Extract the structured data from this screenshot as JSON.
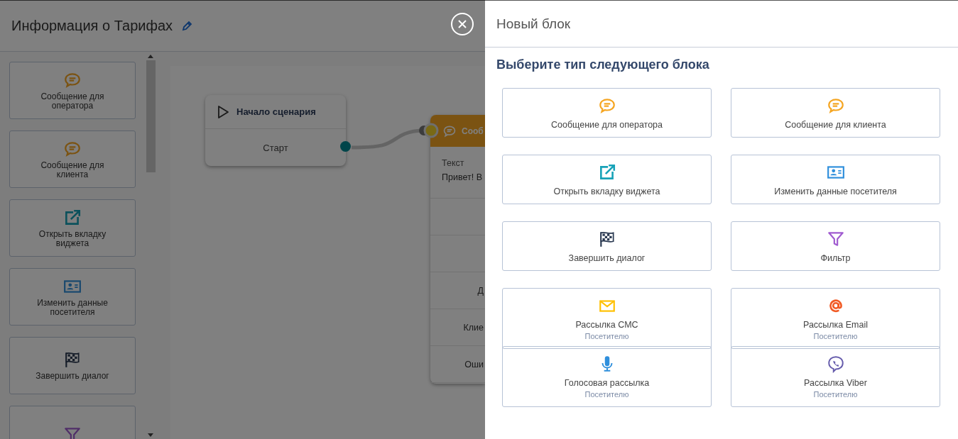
{
  "editor": {
    "title": "Информация о Тарифах"
  },
  "palette": [
    {
      "kind": "chat",
      "label": "Сообщение для оператора"
    },
    {
      "kind": "chat",
      "label": "Сообщение для клиента"
    },
    {
      "kind": "external",
      "label": "Открыть вкладку виджета"
    },
    {
      "kind": "contact",
      "label": "Изменить данные посетителя"
    },
    {
      "kind": "flag",
      "label": "Завершить диалог"
    },
    {
      "kind": "filter"
    }
  ],
  "canvas": {
    "start_node": {
      "title": "Начало сценария",
      "output": "Старт"
    },
    "message_node": {
      "title": "Сооб",
      "field_label": "Текст",
      "field_value": "Привет! В",
      "rows": [
        "",
        "",
        "Д",
        "Клие",
        "Оши"
      ]
    }
  },
  "panel": {
    "title": "Новый блок",
    "subtitle": "Выберите тип следующего блока",
    "options": [
      {
        "kind": "chat",
        "label": "Сообщение для оператора"
      },
      {
        "kind": "chat",
        "label": "Сообщение для клиента"
      },
      {
        "kind": "external",
        "label": "Открыть вкладку виджета"
      },
      {
        "kind": "contact",
        "label": "Изменить данные посетителя"
      },
      {
        "kind": "flag",
        "label": "Завершить диалог"
      },
      {
        "kind": "filter",
        "label": "Фильтр"
      },
      {
        "kind": "mail",
        "label": "Рассылка СМС",
        "sublabel": "Посетителю"
      },
      {
        "kind": "at",
        "label": "Рассылка Email",
        "sublabel": "Посетителю"
      },
      {
        "kind": "mic",
        "label": "Голосовая рассылка",
        "sublabel": "Посетителю"
      },
      {
        "kind": "viber",
        "label": "Рассылка Viber",
        "sublabel": "Посетителю"
      }
    ]
  }
}
